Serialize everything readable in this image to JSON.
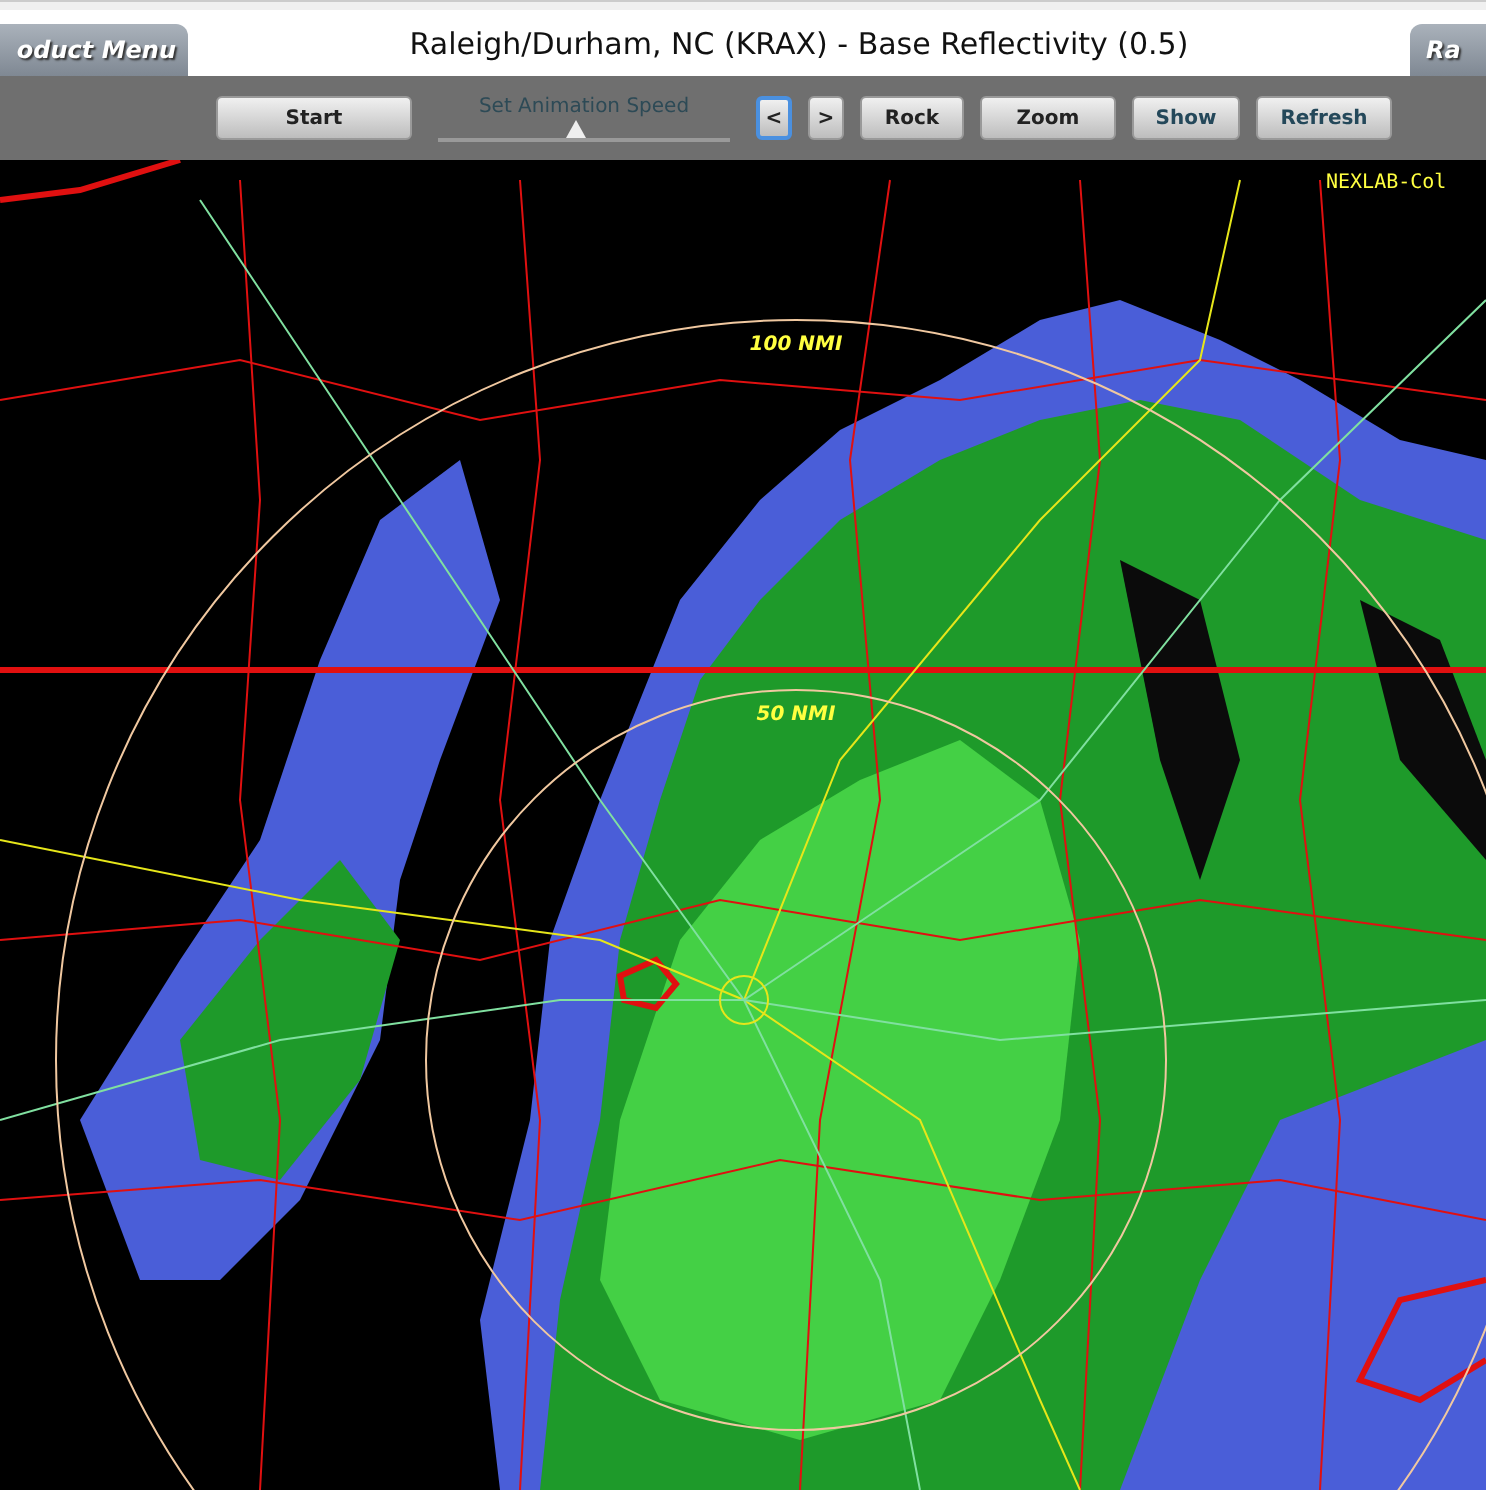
{
  "header": {
    "left_tab": "oduct Menu",
    "title": "Raleigh/Durham, NC (KRAX) - Base Reflectivity (0.5)",
    "right_tab": "Ra"
  },
  "toolbar": {
    "start_button": "Start",
    "speed_slider": {
      "label": "Set Animation Speed",
      "level": 0.47
    },
    "step_buttons": [
      {
        "label": "<",
        "selected": true
      },
      {
        "label": ">",
        "selected": false
      }
    ],
    "buttons": [
      "Rock",
      "Zoom",
      "Show",
      "Refresh"
    ]
  },
  "map": {
    "credit": "NEXLAB-Col",
    "range_labels": [
      "100 NMI",
      "50 NMI"
    ]
  }
}
